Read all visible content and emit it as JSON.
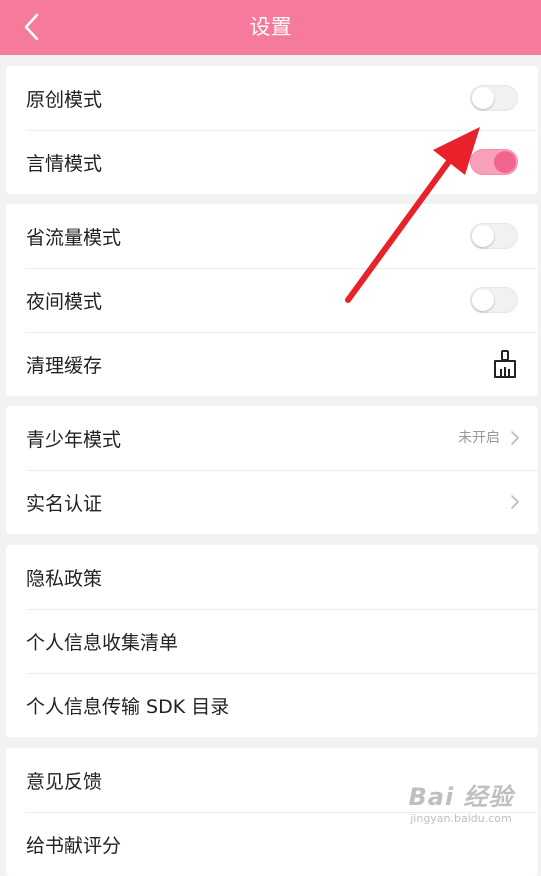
{
  "header": {
    "title": "设置",
    "back_icon": "chevron-left-icon",
    "background": "#f57a9b"
  },
  "groups": {
    "modes": {
      "original_mode": {
        "label": "原创模式",
        "toggle": "off"
      },
      "yanqing_mode": {
        "label": "言情模式",
        "toggle": "on"
      }
    },
    "settings": {
      "data_saver": {
        "label": "省流量模式",
        "toggle": "off"
      },
      "night_mode": {
        "label": "夜间模式",
        "toggle": "off"
      },
      "clear_cache": {
        "label": "清理缓存",
        "icon": "broom-icon"
      }
    },
    "account": {
      "teen_mode": {
        "label": "青少年模式",
        "status": "未开启"
      },
      "real_name": {
        "label": "实名认证"
      }
    },
    "privacy": {
      "privacy_policy": {
        "label": "隐私政策"
      },
      "info_collection": {
        "label": "个人信息收集清单"
      },
      "sdk_list": {
        "label": "个人信息传输 SDK 目录"
      }
    },
    "feedback": {
      "feedback": {
        "label": "意见反馈"
      },
      "rate": {
        "label": "给书献评分"
      }
    }
  },
  "watermark": {
    "text": "Bai 经验",
    "sub": "jingyan.baidu.com"
  },
  "colors": {
    "accent": "#f57a9b",
    "toggle_on": "#f2648d",
    "arrow": "#e8212a"
  }
}
